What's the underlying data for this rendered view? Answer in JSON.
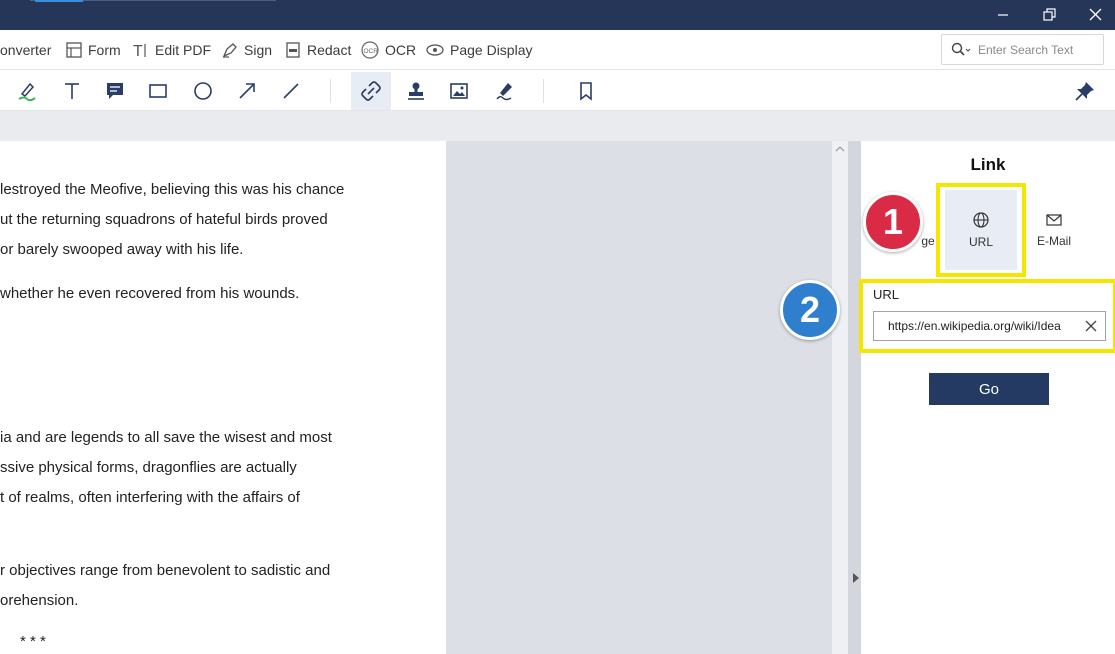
{
  "menu": {
    "items": [
      {
        "label": "onverter",
        "icon": "converter-icon"
      },
      {
        "label": "Form",
        "icon": "form-icon"
      },
      {
        "label": "Edit PDF",
        "icon": "edit-pdf-icon"
      },
      {
        "label": "Sign",
        "icon": "sign-icon"
      },
      {
        "label": "Redact",
        "icon": "redact-icon"
      },
      {
        "label": "OCR",
        "icon": "ocr-icon"
      },
      {
        "label": "Page Display",
        "icon": "page-display-icon"
      }
    ],
    "search_placeholder": "Enter Search Text"
  },
  "toolbar": {
    "tools": [
      "highlighter-icon",
      "text-icon",
      "comment-icon",
      "rectangle-icon",
      "ellipse-icon",
      "arrow-icon",
      "line-icon",
      "link-icon",
      "stamp-icon",
      "image-icon",
      "signature-pen-icon",
      "bookmark-icon",
      "pin-icon"
    ],
    "active_tool": "link-icon"
  },
  "document": {
    "lines": [
      "lestroyed the Meofive, believing this was his chance",
      "ut the returning squadrons of hateful birds proved",
      "or barely swooped away with his life.",
      "whether he even recovered from his wounds.",
      "ia and are legends to all save the wisest and most",
      "ssive physical forms, dragonflies are actually",
      "t of realms, often interfering with the affairs of",
      "r objectives range from benevolent to sadistic and",
      "orehension.",
      "* * *"
    ]
  },
  "panel": {
    "title": "Link",
    "link_types": [
      {
        "label": "ge",
        "icon": "page-icon"
      },
      {
        "label": "URL",
        "icon": "globe-icon"
      },
      {
        "label": "E-Mail",
        "icon": "mail-icon"
      }
    ],
    "selected_type": "URL",
    "url_label": "URL",
    "url_value": "https://en.wikipedia.org/wiki/Idea",
    "go_label": "Go"
  },
  "annotations": {
    "badge_1": "1",
    "badge_2": "2",
    "highlight_color": "#f5e600",
    "badge_1_color": "#d92b45",
    "badge_2_color": "#2f7fce"
  },
  "colors": {
    "titlebar": "#253659",
    "go_button": "#243a63",
    "canvas": "#dcdfe5"
  }
}
